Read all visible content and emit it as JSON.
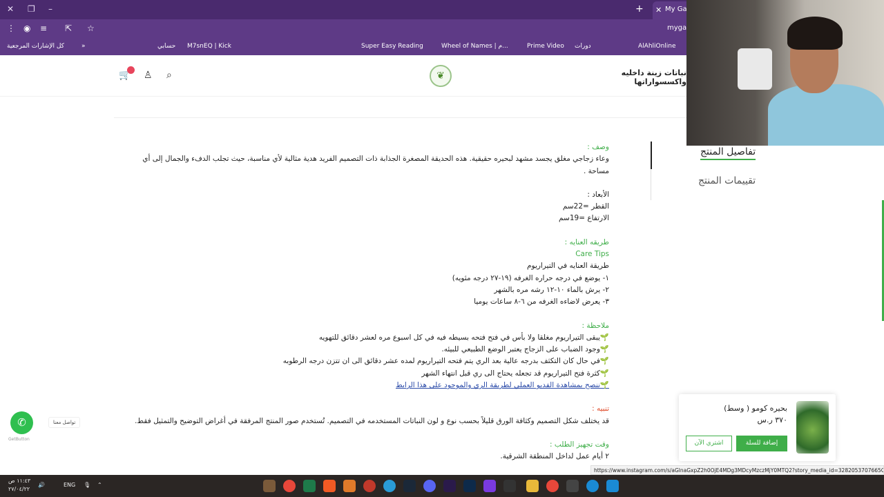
{
  "browser": {
    "tab_title": "My Gard",
    "url": "mygar",
    "bookmarks": [
      "كل الإشارات المرجعية",
      "حسابي",
      "M7snEQ | Kick",
      "Super Easy Reading",
      "Wheel of Names | م...",
      "Prime Video",
      "دورات",
      "AlAhliOnline"
    ]
  },
  "site": {
    "brand": "نباتات زينة داخليه واكسسواراتها",
    "logo_text": "❦"
  },
  "description": {
    "heading": "وصف :",
    "intro": "وعاء زجاجي مغلق يجسد مشهد لبحيره حقيقية. هذه الحديقة المصغرة الجذابة ذات التصميم الفريد هدية مثالية لأي مناسبة، حيث تجلب الدفء والجمال إلى أي مساحة .",
    "dims_label": "الأبعاد :",
    "diameter": "القطر =22سم",
    "height": "الارتفاع =19سم",
    "care_heading": "طريقه العنايه :",
    "care_tips": "Care Tips",
    "care_intro": "طريقة العنايه في التيراريوم",
    "care_items": [
      "١- يوضع في درجه حراره الغرفه (١٩-٢٧ درجه مئويه)",
      "٢- يرش بالماء ١٠-١٢ رشه مره بالشهر",
      "٣- يعرض لاضاءه الغرفه من ٦-٨ ساعات يوميا"
    ],
    "note_heading": "ملاحظة :",
    "notes": [
      "🌱يبقى التيراريوم مغلقا ولا بأس في فتح فتحه بسيطه فيه في كل اسبوع مره لعشر دقائق للتهويه",
      "🌱وجود الضباب على الزجاج يعتبر الوضع الطبيعي للبيئه.",
      "🌱في حال كان التكثف بدرجه عالية بعد الري يتم فتحه التيراريوم لمده عشر دقائق الى ان تتزن درجه الرطوبه",
      "🌱كثرة فتح التيراريوم قد تجعله يحتاج الى ري قبل انتهاء الشهر"
    ],
    "note_link": "🌱ننصح بمشاهدة الفديو العملي لطريقة الري والموجود على هذا الرابط",
    "warning_heading": "تنبيه :",
    "warning": "قد يختلف شكل التصميم وكثافة الورق قليلاً بحسب نوع و لون النباتات المستخدمه في التصميم. تُستخدم صور المنتج المرفقة في أغراض التوضيح والتمثيل فقط.",
    "prep_heading": "وقت تجهيز الطلب :",
    "prep_text": "٢ أيام عمل لداخل المنطقة الشرقية."
  },
  "side_tabs": {
    "details": "تفاصيل المنتج",
    "reviews": "تقييمات المنتج"
  },
  "cart_card": {
    "name": "بحيره كومو ( وسط)",
    "price": "٣٧٠ ر.س",
    "add_label": "إضافة للسلة",
    "buy_label": "اشتري الآن"
  },
  "whatsapp": {
    "label": "تواصل معنا",
    "credit": "GetButton"
  },
  "status_url": "https://www.instagram.com/s/aGlnaGxpZ2h0OjE4MDg3MDcyMzczMjY0MTQ2?story_media_id=3282053707665O638...",
  "taskbar": {
    "time": "١١:٤٣ ص",
    "date": "٢٧/٠٤/٢٢",
    "lang": "ENG"
  },
  "colors": {
    "accent": "#3fae49",
    "browser": "#5e3a86"
  }
}
